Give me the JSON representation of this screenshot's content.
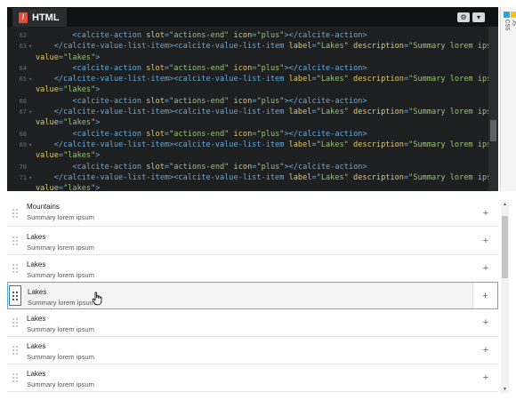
{
  "editor": {
    "tab_label": "HTML",
    "tab_badge": "/",
    "gear_icon": "gear-icon",
    "chevron_icon": "chevron-down-icon",
    "accent": "#e54b3a"
  },
  "code_lines": [
    {
      "num": "62",
      "fold": "",
      "indent": "        ",
      "parts": [
        {
          "t": "tag",
          "v": "<calcite-action "
        },
        {
          "t": "attr",
          "v": "slot"
        },
        {
          "t": "tag",
          "v": "="
        },
        {
          "t": "str",
          "v": "\"actions-end\""
        },
        {
          "t": "tag",
          "v": " "
        },
        {
          "t": "attr",
          "v": "icon"
        },
        {
          "t": "tag",
          "v": "="
        },
        {
          "t": "str",
          "v": "\"plus\""
        },
        {
          "t": "tag",
          "v": "></calcite-action>"
        }
      ]
    },
    {
      "num": "63",
      "fold": "▾",
      "indent": "    ",
      "parts": [
        {
          "t": "tag",
          "v": "</calcite-value-list-item><calcite-value-list-item "
        },
        {
          "t": "attr",
          "v": "label"
        },
        {
          "t": "tag",
          "v": "="
        },
        {
          "t": "str",
          "v": "\"Lakes\""
        },
        {
          "t": "tag",
          "v": " "
        },
        {
          "t": "attr",
          "v": "description"
        },
        {
          "t": "tag",
          "v": "="
        },
        {
          "t": "str",
          "v": "\"Summary lorem ipsum\""
        }
      ]
    },
    {
      "num": "",
      "fold": "",
      "indent": "",
      "parts": [
        {
          "t": "attr",
          "v": "value"
        },
        {
          "t": "tag",
          "v": "="
        },
        {
          "t": "str",
          "v": "\"lakes\""
        },
        {
          "t": "tag",
          "v": ">"
        }
      ]
    },
    {
      "num": "64",
      "fold": "",
      "indent": "        ",
      "parts": [
        {
          "t": "tag",
          "v": "<calcite-action "
        },
        {
          "t": "attr",
          "v": "slot"
        },
        {
          "t": "tag",
          "v": "="
        },
        {
          "t": "str",
          "v": "\"actions-end\""
        },
        {
          "t": "tag",
          "v": " "
        },
        {
          "t": "attr",
          "v": "icon"
        },
        {
          "t": "tag",
          "v": "="
        },
        {
          "t": "str",
          "v": "\"plus\""
        },
        {
          "t": "tag",
          "v": "></calcite-action>"
        }
      ]
    },
    {
      "num": "65",
      "fold": "▾",
      "indent": "    ",
      "parts": [
        {
          "t": "tag",
          "v": "</calcite-value-list-item><calcite-value-list-item "
        },
        {
          "t": "attr",
          "v": "label"
        },
        {
          "t": "tag",
          "v": "="
        },
        {
          "t": "str",
          "v": "\"Lakes\""
        },
        {
          "t": "tag",
          "v": " "
        },
        {
          "t": "attr",
          "v": "description"
        },
        {
          "t": "tag",
          "v": "="
        },
        {
          "t": "str",
          "v": "\"Summary lorem ipsum\""
        }
      ]
    },
    {
      "num": "",
      "fold": "",
      "indent": "",
      "parts": [
        {
          "t": "attr",
          "v": "value"
        },
        {
          "t": "tag",
          "v": "="
        },
        {
          "t": "str",
          "v": "\"lakes\""
        },
        {
          "t": "tag",
          "v": ">"
        }
      ]
    },
    {
      "num": "66",
      "fold": "",
      "indent": "        ",
      "parts": [
        {
          "t": "tag",
          "v": "<calcite-action "
        },
        {
          "t": "attr",
          "v": "slot"
        },
        {
          "t": "tag",
          "v": "="
        },
        {
          "t": "str",
          "v": "\"actions-end\""
        },
        {
          "t": "tag",
          "v": " "
        },
        {
          "t": "attr",
          "v": "icon"
        },
        {
          "t": "tag",
          "v": "="
        },
        {
          "t": "str",
          "v": "\"plus\""
        },
        {
          "t": "tag",
          "v": "></calcite-action>"
        }
      ]
    },
    {
      "num": "67",
      "fold": "▾",
      "indent": "    ",
      "parts": [
        {
          "t": "tag",
          "v": "</calcite-value-list-item><calcite-value-list-item "
        },
        {
          "t": "attr",
          "v": "label"
        },
        {
          "t": "tag",
          "v": "="
        },
        {
          "t": "str",
          "v": "\"Lakes\""
        },
        {
          "t": "tag",
          "v": " "
        },
        {
          "t": "attr",
          "v": "description"
        },
        {
          "t": "tag",
          "v": "="
        },
        {
          "t": "str",
          "v": "\"Summary lorem ipsum\""
        }
      ]
    },
    {
      "num": "",
      "fold": "",
      "indent": "",
      "parts": [
        {
          "t": "attr",
          "v": "value"
        },
        {
          "t": "tag",
          "v": "="
        },
        {
          "t": "str",
          "v": "\"lakes\""
        },
        {
          "t": "tag",
          "v": ">"
        }
      ]
    },
    {
      "num": "68",
      "fold": "",
      "indent": "        ",
      "parts": [
        {
          "t": "tag",
          "v": "<calcite-action "
        },
        {
          "t": "attr",
          "v": "slot"
        },
        {
          "t": "tag",
          "v": "="
        },
        {
          "t": "str",
          "v": "\"actions-end\""
        },
        {
          "t": "tag",
          "v": " "
        },
        {
          "t": "attr",
          "v": "icon"
        },
        {
          "t": "tag",
          "v": "="
        },
        {
          "t": "str",
          "v": "\"plus\""
        },
        {
          "t": "tag",
          "v": "></calcite-action>"
        }
      ]
    },
    {
      "num": "69",
      "fold": "▾",
      "indent": "    ",
      "parts": [
        {
          "t": "tag",
          "v": "</calcite-value-list-item><calcite-value-list-item "
        },
        {
          "t": "attr",
          "v": "label"
        },
        {
          "t": "tag",
          "v": "="
        },
        {
          "t": "str",
          "v": "\"Lakes\""
        },
        {
          "t": "tag",
          "v": " "
        },
        {
          "t": "attr",
          "v": "description"
        },
        {
          "t": "tag",
          "v": "="
        },
        {
          "t": "str",
          "v": "\"Summary lorem ipsum\""
        }
      ]
    },
    {
      "num": "",
      "fold": "",
      "indent": "",
      "parts": [
        {
          "t": "attr",
          "v": "value"
        },
        {
          "t": "tag",
          "v": "="
        },
        {
          "t": "str",
          "v": "\"lakes\""
        },
        {
          "t": "tag",
          "v": ">"
        }
      ]
    },
    {
      "num": "70",
      "fold": "",
      "indent": "        ",
      "parts": [
        {
          "t": "tag",
          "v": "<calcite-action "
        },
        {
          "t": "attr",
          "v": "slot"
        },
        {
          "t": "tag",
          "v": "="
        },
        {
          "t": "str",
          "v": "\"actions-end\""
        },
        {
          "t": "tag",
          "v": " "
        },
        {
          "t": "attr",
          "v": "icon"
        },
        {
          "t": "tag",
          "v": "="
        },
        {
          "t": "str",
          "v": "\"plus\""
        },
        {
          "t": "tag",
          "v": "></calcite-action>"
        }
      ]
    },
    {
      "num": "71",
      "fold": "▾",
      "indent": "    ",
      "parts": [
        {
          "t": "tag",
          "v": "</calcite-value-list-item><calcite-value-list-item "
        },
        {
          "t": "attr",
          "v": "label"
        },
        {
          "t": "tag",
          "v": "="
        },
        {
          "t": "str",
          "v": "\"Lakes\""
        },
        {
          "t": "tag",
          "v": " "
        },
        {
          "t": "attr",
          "v": "description"
        },
        {
          "t": "tag",
          "v": "="
        },
        {
          "t": "str",
          "v": "\"Summary lorem ipsum\""
        }
      ]
    },
    {
      "num": "",
      "fold": "",
      "indent": "",
      "parts": [
        {
          "t": "attr",
          "v": "value"
        },
        {
          "t": "tag",
          "v": "="
        },
        {
          "t": "str",
          "v": "\"lakes\""
        },
        {
          "t": "tag",
          "v": ">"
        }
      ]
    }
  ],
  "rail": {
    "css_label": "CSS",
    "js_label": "JS",
    "css_color": "#2f9fe0",
    "js_color": "#f2c21b"
  },
  "list": {
    "items": [
      {
        "label": "Mountains",
        "description": "Summary lorem ipsum",
        "action_icon": "+"
      },
      {
        "label": "Lakes",
        "description": "Summary lorem ipsum",
        "action_icon": "+"
      },
      {
        "label": "Lakes",
        "description": "Summary lorem ipsum",
        "action_icon": "+"
      },
      {
        "label": "Lakes",
        "description": "Summary lorem ipsum",
        "action_icon": "+",
        "hovered": true
      },
      {
        "label": "Lakes",
        "description": "Summary lorem ipsum",
        "action_icon": "+"
      },
      {
        "label": "Lakes",
        "description": "Summary lorem ipsum",
        "action_icon": "+"
      },
      {
        "label": "Lakes",
        "description": "Summary lorem ipsum",
        "action_icon": "+"
      }
    ]
  }
}
